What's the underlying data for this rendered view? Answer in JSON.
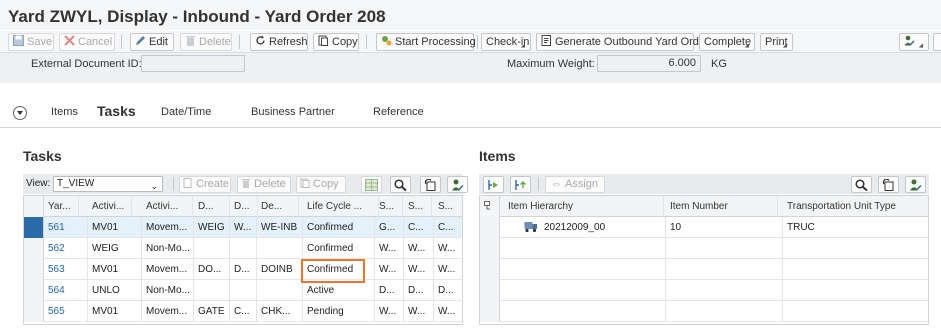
{
  "window": {
    "title": "Yard ZWYL,  Display - Inbound - Yard Order 208"
  },
  "toolbar": {
    "save": "Save",
    "cancel": "Cancel",
    "edit": "Edit",
    "delete": "Delete",
    "refresh": "Refresh",
    "copy": "Copy",
    "start_processing": "Start Processing",
    "check_in": "Check-in",
    "generate_outbound": "Generate Outbound Yard Order",
    "complete": "Complete",
    "print": "Print"
  },
  "header": {
    "ext_doc_label": "External Document ID:",
    "ext_doc_value": "",
    "max_weight_label": "Maximum Weight:",
    "max_weight_value": "6.000",
    "max_weight_unit": "KG"
  },
  "tabs": [
    "Items",
    "Tasks",
    "Date/Time",
    "Business Partner",
    "Reference"
  ],
  "active_tab": "Tasks",
  "tasks": {
    "title": "Tasks",
    "view_label": "View:",
    "view_value": "T_VIEW",
    "create": "Create",
    "delete": "Delete",
    "copy": "Copy",
    "columns": [
      "Yar...",
      "Activi...",
      "Activi...",
      "D...",
      "D...",
      "De...",
      "Life Cycle ...",
      "S...",
      "S...",
      "S..."
    ],
    "rows": [
      [
        "561",
        "MV01",
        "Movem...",
        "WEIG",
        "W...",
        "WE-INB",
        "Confirmed",
        "G...",
        "C...",
        "C..."
      ],
      [
        "562",
        "WEIG",
        "Non-Mo...",
        "",
        "",
        "",
        "Confirmed",
        "W...",
        "W...",
        "W..."
      ],
      [
        "563",
        "MV01",
        "Movem...",
        "DO...",
        "D...",
        "DOINB",
        "Confirmed",
        "W...",
        "W...",
        "W..."
      ],
      [
        "564",
        "UNLO",
        "Non-Mo...",
        "",
        "",
        "",
        "Active",
        "D...",
        "D...",
        "D..."
      ],
      [
        "565",
        "MV01",
        "Movem...",
        "GATE",
        "C...",
        "CHK...",
        "Pending",
        "W...",
        "W...",
        "W..."
      ]
    ]
  },
  "items": {
    "title": "Items",
    "assign": "Assign",
    "columns": [
      "Item Hierarchy",
      "Item Number",
      "Transportation Unit Type"
    ],
    "rows": [
      [
        "20212009_00",
        "10",
        "TRUC"
      ]
    ]
  },
  "colors": {
    "accent": "#2b6aa9",
    "highlight": "#e9782f",
    "link": "#2766a8"
  }
}
